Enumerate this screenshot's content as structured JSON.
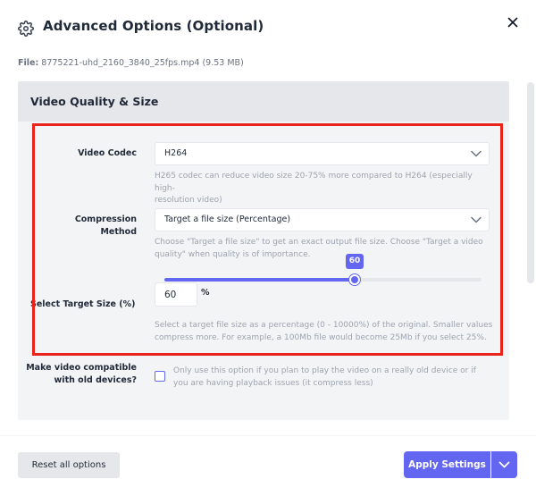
{
  "dialog": {
    "title": "Advanced Options (Optional)",
    "file_label": "File:",
    "file_name": "8775221-uhd_2160_3840_25fps.mp4 (9.53 MB)"
  },
  "section": {
    "title": "Video Quality & Size"
  },
  "video_codec": {
    "label": "Video Codec",
    "value": "H264",
    "help_line1": "H265 codec can reduce video size 20-75% more compared to H264 (especially high-",
    "help_line2": "resolution video)"
  },
  "compression": {
    "label": "Compression Method",
    "value": "Target a file size (Percentage)",
    "help_line1": "Choose \"Target a file size\" to get an exact output file size. Choose \"Target a video",
    "help_line2": "quality\" when quality is of importance."
  },
  "target_size": {
    "label": "Select Target Size (%)",
    "value": "60",
    "slider_value": 60,
    "slider_bubble": "60",
    "unit": "%",
    "help_line1": "Select a target file size as a percentage (0 - 10000%) of the original. Smaller values",
    "help_line2": "compress more. For example, a 100Mb file would become 25Mb if you select 25%."
  },
  "compat": {
    "label_line1": "Make video compatible",
    "label_line2": "with old devices?",
    "checked": false,
    "help_line1": "Only use this option if you plan to play the video on a really old device or if",
    "help_line2": "you are having playback issues (it compress less)"
  },
  "footer": {
    "reset_label": "Reset all options",
    "apply_label": "Apply Settings"
  },
  "colors": {
    "accent": "#6366f1",
    "highlight": "#e8231c"
  },
  "icons": {
    "header": "gear-icon",
    "close": "close-icon",
    "dropdown": "chevron-down-icon"
  }
}
